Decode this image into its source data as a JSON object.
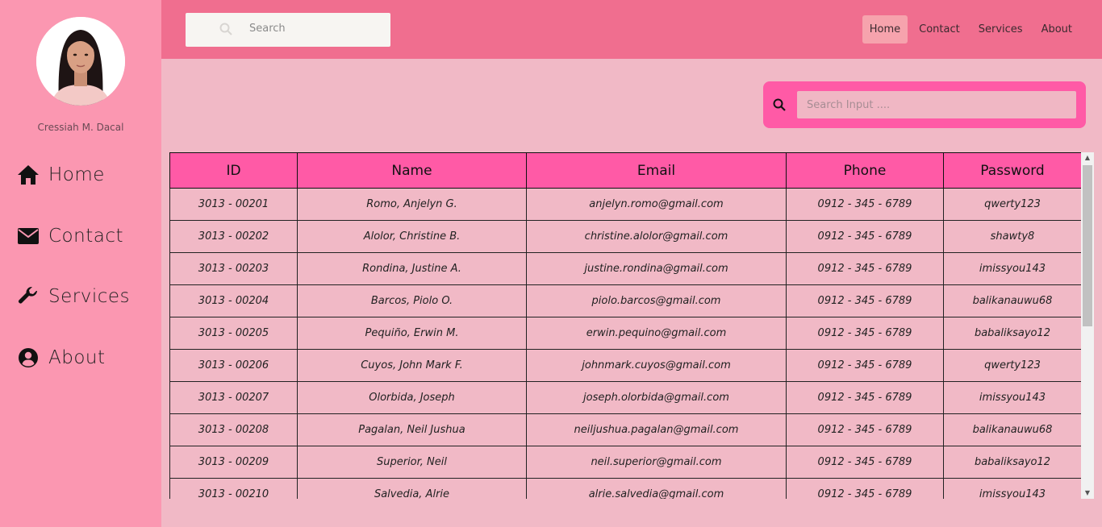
{
  "sidebar": {
    "profile_name": "Cressiah M. Dacal",
    "items": [
      {
        "label": "Home",
        "icon": "home-icon"
      },
      {
        "label": "Contact",
        "icon": "envelope-icon"
      },
      {
        "label": "Services",
        "icon": "wrench-icon"
      },
      {
        "label": "About",
        "icon": "user-circle-icon"
      }
    ]
  },
  "topbar": {
    "search_placeholder": "Search",
    "nav": [
      {
        "label": "Home",
        "active": true
      },
      {
        "label": "Contact",
        "active": false
      },
      {
        "label": "Services",
        "active": false
      },
      {
        "label": "About",
        "active": false
      }
    ]
  },
  "panel": {
    "search_placeholder": "Search Input ...."
  },
  "table": {
    "headers": [
      "ID",
      "Name",
      "Email",
      "Phone",
      "Password"
    ],
    "rows": [
      [
        "3013 - 00201",
        "Romo, Anjelyn G.",
        "anjelyn.romo@gmail.com",
        "0912 - 345 - 6789",
        "qwerty123"
      ],
      [
        "3013 - 00202",
        "Alolor, Christine B.",
        "christine.alolor@gmail.com",
        "0912 - 345 - 6789",
        "shawty8"
      ],
      [
        "3013 - 00203",
        "Rondina, Justine A.",
        "justine.rondina@gmail.com",
        "0912 - 345 - 6789",
        "imissyou143"
      ],
      [
        "3013 - 00204",
        "Barcos, Piolo O.",
        "piolo.barcos@gmail.com",
        "0912 - 345 - 6789",
        "balikanauwu68"
      ],
      [
        "3013 - 00205",
        "Pequiño, Erwin M.",
        "erwin.pequino@gmail.com",
        "0912 - 345 - 6789",
        "babaliksayo12"
      ],
      [
        "3013 - 00206",
        "Cuyos, John Mark F.",
        "johnmark.cuyos@gmail.com",
        "0912 - 345 - 6789",
        "qwerty123"
      ],
      [
        "3013 - 00207",
        "Olorbida, Joseph",
        "joseph.olorbida@gmail.com",
        "0912 - 345 - 6789",
        "imissyou143"
      ],
      [
        "3013 - 00208",
        "Pagalan, Neil Jushua",
        "neiljushua.pagalan@gmail.com",
        "0912 - 345 - 6789",
        "balikanauwu68"
      ],
      [
        "3013 - 00209",
        "Superior, Neil",
        "neil.superior@gmail.com",
        "0912 - 345 - 6789",
        "babaliksayo12"
      ],
      [
        "3013 - 00210",
        "Salvedia, Alrie",
        "alrie.salvedia@gmail.com",
        "0912 - 345 - 6789",
        "imissyou143"
      ]
    ]
  },
  "colors": {
    "sidebar_bg": "#fb97b1",
    "topbar_bg": "#f06e8f",
    "accent": "#ff5aa6",
    "page_bg": "#f1b9c6"
  }
}
